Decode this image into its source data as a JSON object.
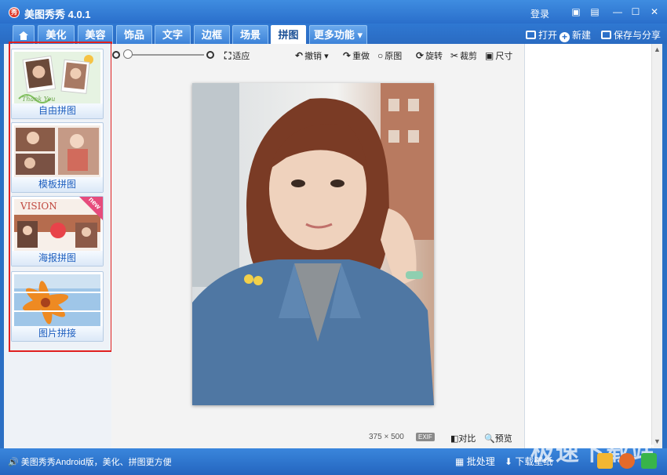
{
  "window": {
    "app_logo": "秀",
    "title": "美图秀秀 4.0.1",
    "login": "登录"
  },
  "tabs": [
    {
      "label": "美化"
    },
    {
      "label": "美容"
    },
    {
      "label": "饰品"
    },
    {
      "label": "文字"
    },
    {
      "label": "边框"
    },
    {
      "label": "场景"
    },
    {
      "label": "拼图"
    },
    {
      "label": "更多功能 ▾"
    }
  ],
  "toolbar_right": {
    "open": "打开",
    "new": "新建",
    "save_share": "保存与分享"
  },
  "left_panel": {
    "cards": [
      {
        "label": "自由拼图",
        "thumb_text": "Thank You"
      },
      {
        "label": "模板拼图"
      },
      {
        "label": "海报拼图",
        "thumb_text": "VISION",
        "badge": "new"
      },
      {
        "label": "图片拼接"
      }
    ]
  },
  "zoom_bar": {
    "fit": "适应"
  },
  "edit_toolbar": {
    "undo": "撤销",
    "redo": "重做",
    "original": "原图",
    "rotate": "旋转",
    "crop": "裁剪",
    "size": "尺寸"
  },
  "image_info": {
    "width": "375",
    "times": "×",
    "height": "500",
    "exif": "EXIF"
  },
  "bottom_tools": {
    "compare": "对比",
    "preview": "预览"
  },
  "statusbar": {
    "message": "美图秀秀Android版，美化、拼图更方便",
    "batch": "批处理",
    "download": "下载壁纸",
    "watermark": "极速下载站"
  }
}
